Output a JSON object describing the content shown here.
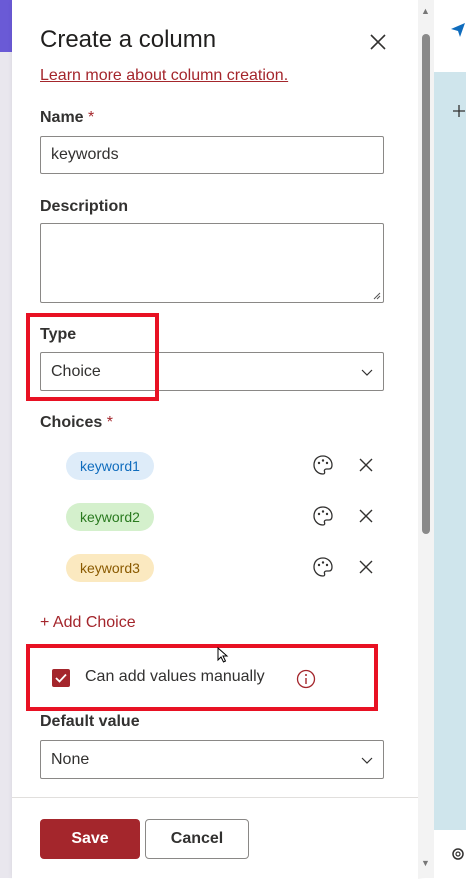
{
  "panel": {
    "title": "Create a column",
    "learn_link": "Learn more about column creation.",
    "name_label": "Name",
    "name_value": "keywords",
    "description_label": "Description",
    "description_value": "",
    "type_label": "Type",
    "type_value": "Choice",
    "choices_label": "Choices",
    "required_marker": "*",
    "choices": [
      {
        "label": "keyword1",
        "bg": "#deecf9",
        "fg": "#0f6cbd"
      },
      {
        "label": "keyword2",
        "bg": "#d4f0cc",
        "fg": "#2a7a1f"
      },
      {
        "label": "keyword3",
        "bg": "#fbe9c0",
        "fg": "#8a5a00"
      }
    ],
    "add_choice": "Add Choice",
    "add_choice_icon": "+",
    "manual_label": "Can add values manually",
    "manual_checked": true,
    "default_label": "Default value",
    "default_value": "None",
    "save": "Save",
    "cancel": "Cancel"
  },
  "colors": {
    "accent": "#a4262c",
    "highlight": "#e81123"
  }
}
